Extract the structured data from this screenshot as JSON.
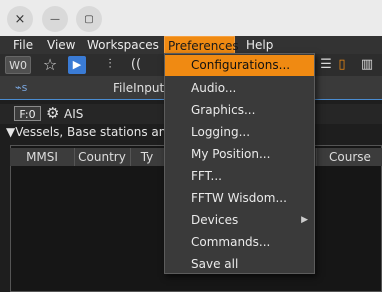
{
  "titlebar": {
    "close_icon": "×",
    "minimize_icon": "—",
    "maximize_icon": "▢"
  },
  "menubar": {
    "items": [
      "File",
      "View",
      "Workspaces",
      "Preferences",
      "Help"
    ]
  },
  "toolbar": {
    "workspace_label": "W0"
  },
  "tab": {
    "title": "FileInput",
    "icon": "⌁s"
  },
  "panel": {
    "frame_label": "F:0",
    "title": "AIS"
  },
  "tree": {
    "label": "▼Vessels, Base stations and"
  },
  "table": {
    "columns": [
      "MMSI",
      "Country",
      "Ty",
      "Course"
    ]
  },
  "preferences_menu": {
    "items": [
      "Configurations...",
      "Audio...",
      "Graphics...",
      "Logging...",
      "My Position...",
      "FFT...",
      "FFTW Wisdom...",
      "Devices",
      "Commands...",
      "Save all"
    ],
    "highlighted": "Configurations...",
    "submenu_item": "Devices"
  },
  "colors": {
    "accent": "#f08a12",
    "background": "#1e1e1e",
    "menu_bg": "#3a3a3a"
  }
}
